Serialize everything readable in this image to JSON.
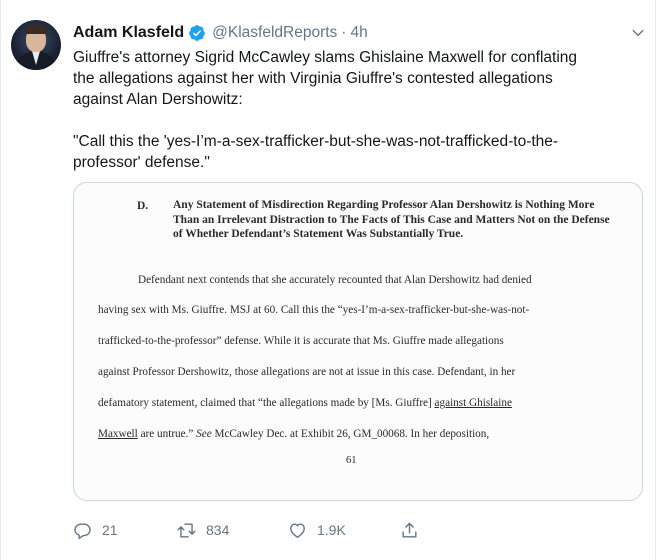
{
  "tweet": {
    "author_name": "Adam Klasfeld",
    "handle": "@KlasfeldReports",
    "separator": "·",
    "time": "4h",
    "text_lines": [
      "Giuffre's attorney Sigrid McCawley slams Ghislaine Maxwell for conflating",
      "the allegations against her with Virginia Giuffre's contested allegations",
      "against Alan Dershowitz:"
    ],
    "quote_lines": [
      "\"Call this the 'yes-I’m-a-sex-trafficker-but-she-was-not-trafficked-to-the-",
      "professor' defense.\""
    ]
  },
  "document": {
    "section_letter": "D.",
    "section_title": "Any Statement of Misdirection Regarding Professor Alan Dershowitz is Nothing More Than an Irrelevant Distraction to The Facts of This Case and Matters Not on the Defense of Whether Defendant’s Statement Was Substantially True.",
    "lines": [
      "Defendant next contends that she accurately recounted that Alan Dershowitz had denied",
      "having sex with Ms. Giuffre. MSJ at 60. Call this the “yes-I’m-a-sex-trafficker-but-she-was-not-",
      "trafficked-to-the-professor” defense. While it is accurate that Ms. Giuffre made allegations",
      "against Professor Dershowitz, those allegations are not at issue in this case. Defendant, in her"
    ],
    "line5_pre": "defamatory statement, claimed that “the allegations made by [Ms. Giuffre] ",
    "line5_underlined": "against Ghislaine",
    "line6_underlined": "Maxwell",
    "line6_mid": " are untrue.” ",
    "line6_italic": "See",
    "line6_post": " McCawley Dec. at Exhibit 26, GM_00068. In her deposition,",
    "page_number": "61"
  },
  "actions": {
    "reply_count": "21",
    "retweet_count": "834",
    "like_count": "1.9K"
  },
  "colors": {
    "verified_blue": "#1da1f2",
    "secondary_text": "#657786",
    "border": "#ccd6dd"
  },
  "icons": [
    "verified-badge-icon",
    "caret-down-icon",
    "reply-icon",
    "retweet-icon",
    "like-icon",
    "share-icon"
  ]
}
